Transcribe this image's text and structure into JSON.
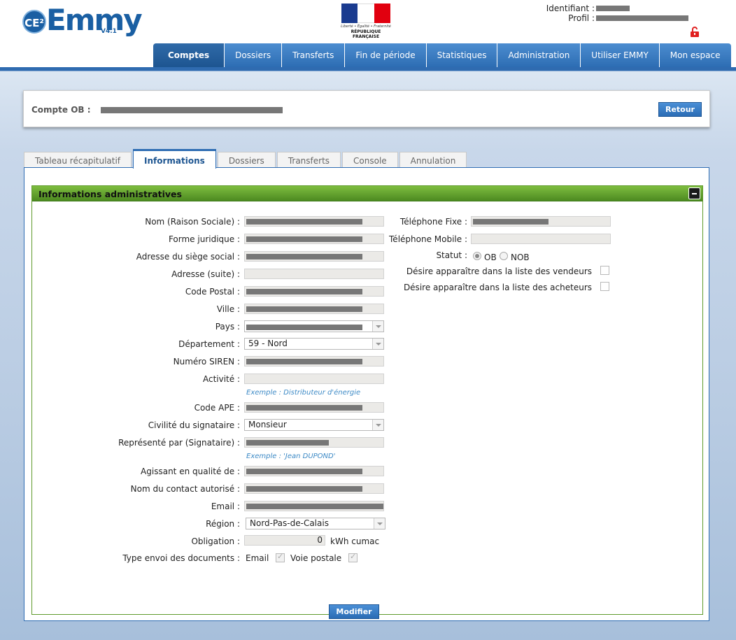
{
  "header": {
    "logo_ce": "CE²",
    "logo_text": "Emmy",
    "logo_version": "V4.1",
    "rf_motto": "Liberté • Égalité • Fraternité",
    "rf_name": "RÉPUBLIQUE FRANÇAISE",
    "identifiant_label": "Identifiant :",
    "profil_label": "Profil :",
    "colors": {
      "flag_blue": "#1a3b8f",
      "flag_white": "#ffffff",
      "flag_red": "#e1000f",
      "brand": "#1a5fa3"
    }
  },
  "nav": {
    "items": [
      "Comptes",
      "Dossiers",
      "Transferts",
      "Fin de période",
      "Statistiques",
      "Administration",
      "Utiliser EMMY",
      "Mon espace"
    ]
  },
  "account": {
    "label": "Compte OB :",
    "retour": "Retour"
  },
  "tabs": [
    "Tableau récapitulatif",
    "Informations",
    "Dossiers",
    "Transferts",
    "Console",
    "Annulation"
  ],
  "section": {
    "title": "Informations administratives"
  },
  "form": {
    "nom": "Nom (Raison Sociale) :",
    "forme": "Forme juridique :",
    "adresse": "Adresse du siège social :",
    "adresse_suite": "Adresse (suite) :",
    "cp": "Code Postal :",
    "ville": "Ville :",
    "pays": "Pays :",
    "departement": "Département :",
    "departement_value": "59 - Nord",
    "siren": "Numéro SIREN :",
    "activite": "Activité :",
    "activite_hint": "Exemple : Distributeur d'énergie",
    "ape": "Code APE :",
    "civilite": "Civilité du signataire :",
    "civilite_value": "Monsieur",
    "represente": "Représenté par (Signataire) :",
    "represente_hint": "Exemple : 'Jean DUPOND'",
    "agissant": "Agissant en qualité de :",
    "contact": "Nom du contact autorisé :",
    "email": "Email :",
    "region": "Région :",
    "region_value": "Nord-Pas-de-Calais",
    "obligation": "Obligation :",
    "obligation_value": "0",
    "obligation_unit": "kWh cumac",
    "type_envoi": "Type envoi des documents :",
    "envoi_email": "Email",
    "envoi_postale": "Voie postale",
    "tel_fixe": "Téléphone Fixe :",
    "tel_mobile": "Téléphone Mobile :",
    "statut": "Statut :",
    "statut_ob": "OB",
    "statut_nob": "NOB",
    "vendeurs": "Désire apparaître dans la liste des vendeurs",
    "acheteurs": "Désire apparaître dans la liste des acheteurs",
    "modifier": "Modifier"
  }
}
